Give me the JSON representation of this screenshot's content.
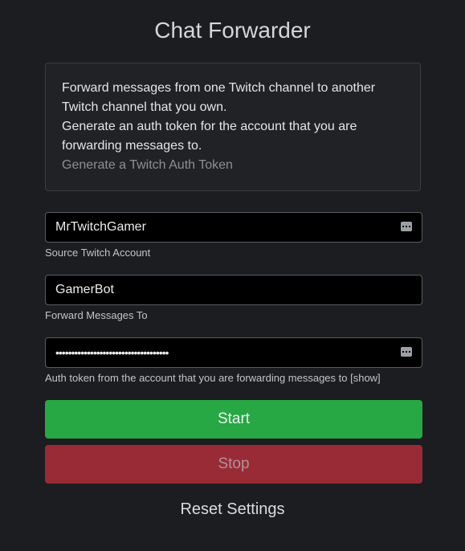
{
  "header": {
    "title": "Chat Forwarder"
  },
  "info": {
    "line1": "Forward messages from one Twitch channel to another Twitch channel that you own.",
    "line2": "Generate an auth token for the account that you are forwarding messages to.",
    "link_label": "Generate a Twitch Auth Token"
  },
  "form": {
    "source": {
      "value": "MrTwitchGamer",
      "helper": "Source Twitch Account"
    },
    "forward_to": {
      "value": "GamerBot",
      "helper": "Forward Messages To"
    },
    "auth": {
      "value": "••••••••••••••••••••••••••••••••••••",
      "helper": "Auth token from the account that you are forwarding messages to [show]"
    }
  },
  "buttons": {
    "start_label": "Start",
    "stop_label": "Stop",
    "reset_label": "Reset Settings"
  },
  "colors": {
    "background": "#1b1d21",
    "start": "#28a745",
    "stop": "#992b37"
  },
  "icons": {
    "autofill": "password-manager-autofill-icon"
  }
}
